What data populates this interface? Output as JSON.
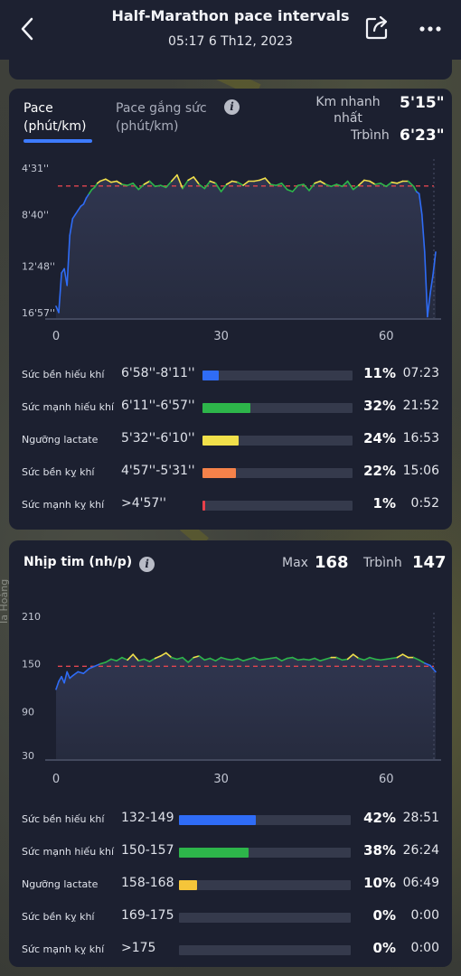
{
  "header": {
    "title": "Half-Marathon pace intervals",
    "subtitle": "05:17 6 Th12, 2023"
  },
  "map": {
    "street_label": "Ia Hoàng"
  },
  "pace_card": {
    "tab_pace": "Pace",
    "tab_pace_unit": "(phút/km)",
    "tab_effort": "Pace gắng sức",
    "tab_effort_unit": "(phút/km)",
    "fastest_label_1": "Km nhanh",
    "fastest_label_2": "nhất",
    "fastest_value": "5'15\"",
    "avg_label": "Trbình",
    "avg_value": "6'23\"",
    "zones": [
      {
        "name": "Sức bền hiếu khí",
        "range": "6'58''-8'11''",
        "pct": "11%",
        "time": "07:23",
        "fraction": 0.11,
        "color": "#2f6cf6"
      },
      {
        "name": "Sức mạnh hiếu khí",
        "range": "6'11''-6'57''",
        "pct": "32%",
        "time": "21:52",
        "fraction": 0.32,
        "color": "#2db54a"
      },
      {
        "name": "Ngưỡng lactate",
        "range": "5'32''-6'10''",
        "pct": "24%",
        "time": "16:53",
        "fraction": 0.24,
        "color": "#f1e04a"
      },
      {
        "name": "Sức bền kỵ khí",
        "range": "4'57''-5'31''",
        "pct": "22%",
        "time": "15:06",
        "fraction": 0.22,
        "color": "#f5824a"
      },
      {
        "name": "Sức mạnh kỵ khí",
        "range": ">4'57''",
        "pct": "1%",
        "time": "0:52",
        "fraction": 0.01,
        "color": "#e8404a"
      }
    ]
  },
  "hr_card": {
    "title": "Nhịp tim (nh/p)",
    "max_label": "Max",
    "max_value": "168",
    "avg_label": "Trbình",
    "avg_value": "147",
    "zones": [
      {
        "name": "Sức bền hiếu khí",
        "range": "132-149",
        "pct": "42%",
        "time": "28:51",
        "fraction": 0.42,
        "color": "#2f6cf6"
      },
      {
        "name": "Sức mạnh hiếu khí",
        "range": "150-157",
        "pct": "38%",
        "time": "26:24",
        "fraction": 0.38,
        "color": "#2db54a"
      },
      {
        "name": "Ngưỡng lactate",
        "range": "158-168",
        "pct": "10%",
        "time": "06:49",
        "fraction": 0.1,
        "color": "#f5c53a"
      },
      {
        "name": "Sức bền kỵ khí",
        "range": "169-175",
        "pct": "0%",
        "time": "0:00",
        "fraction": 0,
        "color": "#f5824a"
      },
      {
        "name": "Sức mạnh kỵ khí",
        "range": ">175",
        "pct": "0%",
        "time": "0:00",
        "fraction": 0,
        "color": "#e8404a"
      }
    ]
  },
  "chart_data": [
    {
      "type": "line",
      "xlabel": "",
      "ylabel": "",
      "x_ticks": [
        "0",
        "30",
        "60"
      ],
      "xlim": [
        0,
        69
      ],
      "y_ticks": [
        "4'31''",
        "8'40''",
        "12'48''",
        "16'57''"
      ],
      "y_tick_values": [
        271,
        520,
        768,
        1017
      ],
      "ylim": [
        271,
        1017
      ],
      "y_inverted": true,
      "avg_line": 383,
      "x": [
        0,
        0.5,
        1,
        1.5,
        2,
        2.5,
        3,
        3.5,
        4,
        4.5,
        5,
        5.5,
        6,
        6.5,
        7,
        7.5,
        8,
        9,
        10,
        11,
        12,
        13,
        14,
        15,
        16,
        17,
        18,
        19,
        20,
        21,
        22,
        23,
        24,
        25,
        26,
        27,
        28,
        29,
        30,
        31,
        32,
        33,
        34,
        35,
        36,
        37,
        38,
        39,
        40,
        41,
        42,
        43,
        44,
        45,
        46,
        47,
        48,
        49,
        50,
        51,
        52,
        53,
        54,
        55,
        56,
        57,
        58,
        59,
        60,
        61,
        62,
        63,
        64,
        65,
        65.5,
        66,
        66.5,
        67,
        67.5,
        68,
        68.5,
        69
      ],
      "values": [
        960,
        990,
        800,
        780,
        860,
        620,
        540,
        520,
        500,
        480,
        470,
        440,
        420,
        400,
        390,
        370,
        360,
        350,
        365,
        360,
        375,
        380,
        370,
        400,
        375,
        360,
        385,
        380,
        390,
        360,
        330,
        395,
        355,
        340,
        375,
        395,
        360,
        370,
        410,
        375,
        360,
        365,
        380,
        360,
        360,
        355,
        345,
        375,
        380,
        370,
        400,
        410,
        380,
        375,
        405,
        370,
        360,
        375,
        385,
        375,
        385,
        360,
        400,
        380,
        355,
        360,
        375,
        370,
        385,
        365,
        370,
        360,
        360,
        385,
        410,
        420,
        520,
        700,
        1010,
        900,
        810,
        700
      ]
    },
    {
      "type": "line",
      "xlabel": "",
      "ylabel": "",
      "x_ticks": [
        "0",
        "30",
        "60"
      ],
      "xlim": [
        0,
        69
      ],
      "y_ticks": [
        "210",
        "150",
        "90",
        "30"
      ],
      "ylim": [
        30,
        210
      ],
      "avg_line": 147,
      "x": [
        0,
        0.5,
        1,
        1.5,
        2,
        2.5,
        3,
        4,
        5,
        6,
        7,
        8,
        9,
        10,
        11,
        12,
        13,
        14,
        15,
        16,
        17,
        18,
        19,
        20,
        21,
        22,
        23,
        24,
        25,
        26,
        27,
        28,
        29,
        30,
        31,
        32,
        33,
        34,
        35,
        36,
        37,
        38,
        39,
        40,
        41,
        42,
        43,
        44,
        45,
        46,
        47,
        48,
        49,
        50,
        51,
        52,
        53,
        54,
        55,
        56,
        57,
        58,
        59,
        60,
        61,
        62,
        63,
        64,
        65,
        66,
        67,
        68,
        69
      ],
      "values": [
        118,
        128,
        134,
        126,
        140,
        132,
        135,
        140,
        138,
        144,
        147,
        150,
        152,
        156,
        154,
        158,
        155,
        162,
        154,
        156,
        153,
        157,
        160,
        164,
        158,
        156,
        158,
        152,
        158,
        160,
        155,
        157,
        154,
        158,
        156,
        155,
        157,
        154,
        156,
        158,
        155,
        156,
        157,
        158,
        154,
        157,
        158,
        155,
        156,
        155,
        157,
        154,
        156,
        158,
        158,
        155,
        156,
        162,
        157,
        155,
        158,
        156,
        155,
        156,
        157,
        158,
        162,
        158,
        158,
        155,
        151,
        148,
        140
      ]
    }
  ]
}
